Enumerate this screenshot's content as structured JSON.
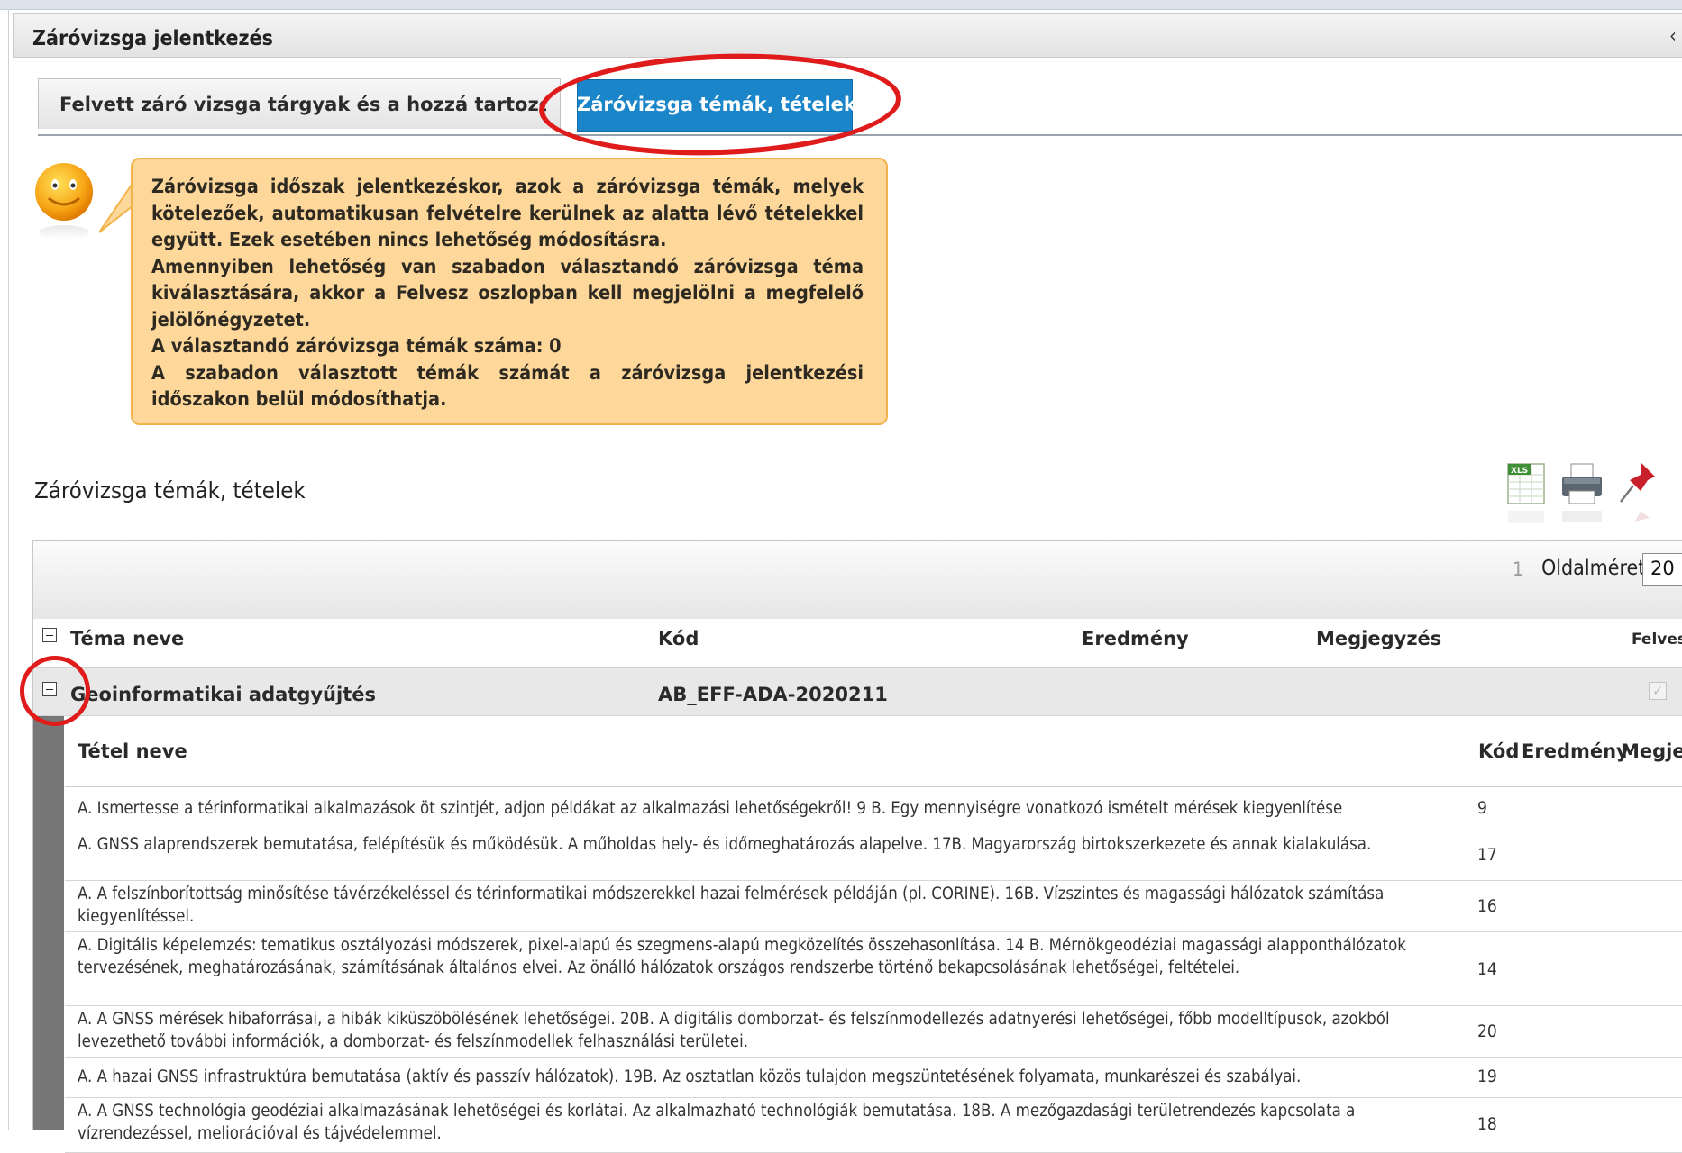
{
  "panel": {
    "title": "Záróvizsga jelentkezés",
    "close_glyph": "‹"
  },
  "tabs": [
    {
      "label": "Felvett záró vizsga tárgyak és a hozzá tartozó vizsgák",
      "active": false
    },
    {
      "label": "Záróvizsga témák, tételek",
      "active": true
    }
  ],
  "info_bubble": {
    "icon": "smiley-icon",
    "paragraphs": [
      "Záróvizsga időszak jelentkezéskor, azok a záróvizsga témák, melyek kötelezőek, automatikusan felvételre kerülnek az alatta lévő tételekkel együtt. Ezek esetében nincs lehetőség módosításra.",
      "Amennyiben lehetőség van szabadon választandó záróvizsga téma kiválasztására, akkor a Felvesz oszlopban kell megjelölni a megfelelő jelölőnégyzetet.",
      "A választandó záróvizsga témák száma: 0",
      "A szabadon választott témák számát a záróvizsga jelentkezési időszakon belül módosíthatja."
    ]
  },
  "section_title": "Záróvizsga témák, tételek",
  "toolbar": {
    "icons": [
      "xls-export-icon",
      "print-icon",
      "pin-icon"
    ]
  },
  "pager": {
    "page": "1",
    "page_size_label": "Oldalméret",
    "page_size": "20"
  },
  "grid": {
    "columns": {
      "tema": "Téma neve",
      "kod": "Kód",
      "eredmeny": "Eredmény",
      "megjegyzes": "Megjegyzés",
      "felvesz": "Felvesz"
    },
    "group": {
      "name": "Geoinformatikai adatgyűjtés",
      "code": "AB_EFF-ADA-2020211",
      "checked": true
    },
    "sub_columns": {
      "tetel": "Tétel neve",
      "kod": "Kód",
      "eredmeny": "Eredmény",
      "megjegyzes": "Megjegyzés"
    },
    "rows": [
      {
        "text": "A. Ismertesse a térinformatikai alkalmazások öt szintjét, adjon példákat az alkalmazási lehetőségekről! 9 B. Egy mennyiségre vonatkozó ismételt mérések kiegyenlítése",
        "code": "9"
      },
      {
        "text": "A. GNSS alaprendszerek bemutatása, felépítésük és működésük. A műholdas hely- és időmeghatározás alapelve. 17B. Magyarország birtokszerkezete és annak kialakulása.",
        "code": "17"
      },
      {
        "text": "A. A felszínborítottság minősítése távérzékeléssel és térinformatikai módszerekkel hazai felmérések példáján (pl. CORINE). 16B. Vízszintes és magassági hálózatok számítása kiegyenlítéssel.",
        "code": "16"
      },
      {
        "text": "A. Digitális képelemzés: tematikus osztályozási módszerek, pixel-alapú és szegmens-alapú megközelítés összehasonlítása. 14 B. Mérnökgeodéziai magassági alapponthálózatok tervezésének, meghatározásának, számításának általános elvei. Az önálló hálózatok országos rendszerbe történő bekapcsolásának lehetőségei, feltételei.",
        "code": "14"
      },
      {
        "text": "A. A GNSS mérések hibaforrásai, a hibák kiküszöbölésének lehetőségei. 20B. A digitális domborzat- és felszínmodellezés adatnyerési lehetőségei, főbb modelltípusok, azokból levezethető további információk, a domborzat- és felszínmodellek felhasználási területei.",
        "code": "20"
      },
      {
        "text": "A. A hazai GNSS infrastruktúra bemutatása (aktív és passzív hálózatok). 19B. Az osztatlan közös tulajdon megszüntetésének folyamata, munkarészei és szabályai.",
        "code": "19"
      },
      {
        "text": "A. A GNSS technológia geodéziai alkalmazásának lehetőségei és korlátai. Az alkalmazható technológiák bemutatása. 18B. A mezőgazdasági területrendezés kapcsolata a vízrendezéssel, meliorációval és tájvédelemmel.",
        "code": "18"
      }
    ]
  },
  "colors": {
    "active_tab": "#1a86c9",
    "bubble_fill": "#fdd89a",
    "bubble_border": "#f2b34a",
    "annotation_red": "#e01b1b"
  }
}
